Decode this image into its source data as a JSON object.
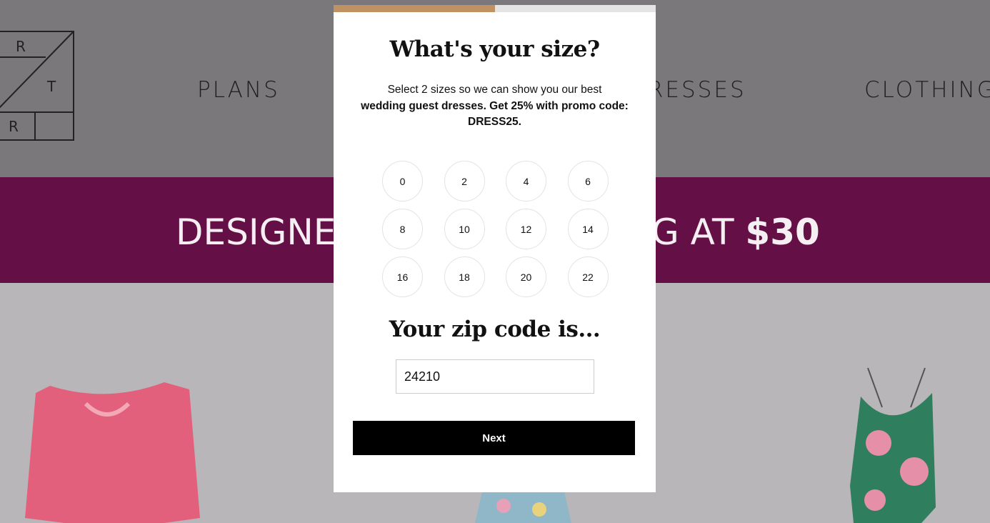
{
  "background": {
    "logo_letters": [
      "R",
      "T",
      "R"
    ],
    "nav": [
      "PLANS",
      "DRESSES",
      "CLOTHING"
    ],
    "banner": {
      "left": "DESIGNE",
      "right": "G AT ",
      "price": "$30"
    },
    "colors": {
      "header": "#7a787b",
      "banner": "#640f45",
      "content": "#b8b6b9"
    }
  },
  "modal": {
    "progress_percent": 50,
    "progress_color": "#c09162",
    "title": "What's your size?",
    "description_regular": "Select 2 sizes so we can show you our best",
    "description_bold": "wedding guest dresses. Get 25% with promo code: DRESS25.",
    "sizes": [
      "0",
      "2",
      "4",
      "6",
      "8",
      "10",
      "12",
      "14",
      "16",
      "18",
      "20",
      "22"
    ],
    "zip_title": "Your zip code is...",
    "zip_value": "24210",
    "next_label": "Next"
  }
}
